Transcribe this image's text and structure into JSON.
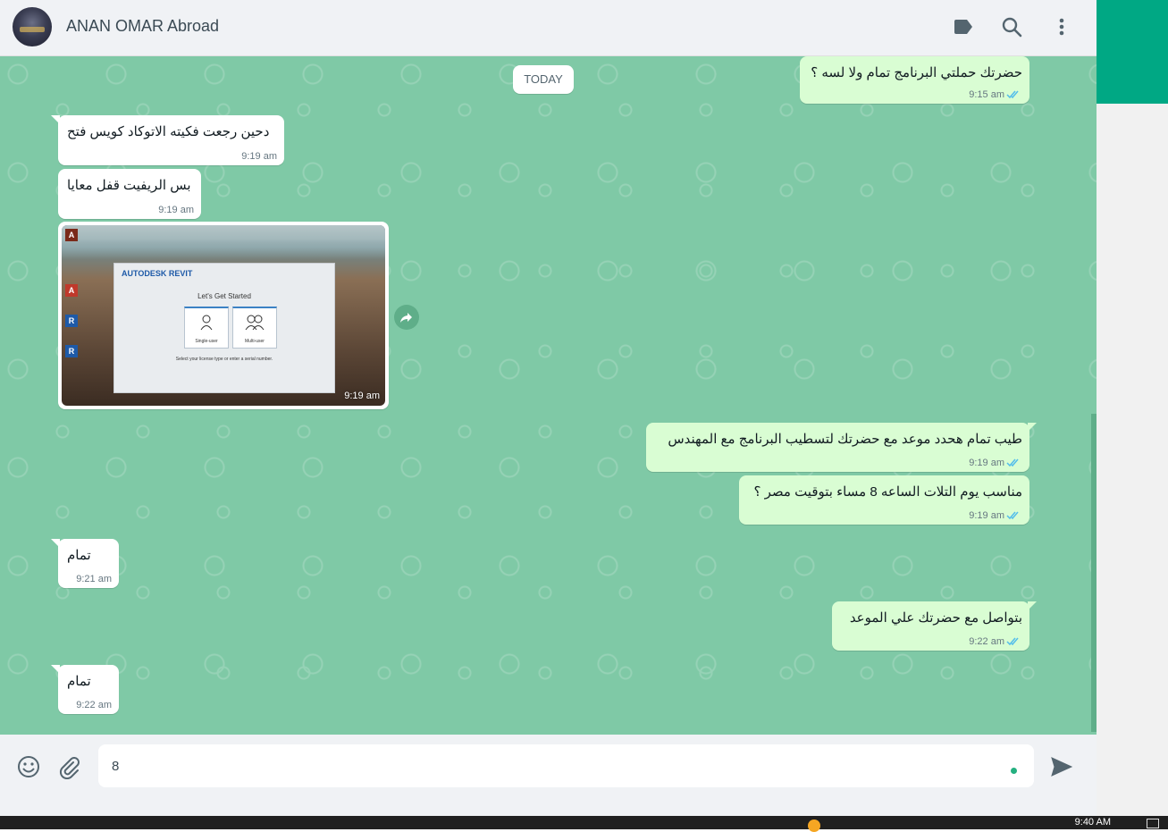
{
  "header": {
    "contact_name": "ANAN OMAR Abroad",
    "icons": [
      "label-icon",
      "search-icon",
      "menu-icon"
    ]
  },
  "chat": {
    "date_divider": "TODAY",
    "messages": [
      {
        "direction": "outgoing",
        "text": "حضرتك حملتي البرنامج تمام ولا لسه ؟",
        "time": "9:15 am",
        "status": "read"
      },
      {
        "direction": "incoming",
        "text": "دحين رجعت فكيته الاتوكاد كويس فتح",
        "time": "9:19 am"
      },
      {
        "direction": "incoming",
        "text": "بس الريفيت قفل معايا",
        "time": "9:19 am"
      },
      {
        "direction": "incoming",
        "type": "image",
        "time": "9:19 am",
        "image": {
          "dialog_logo": "AUTODESK REVIT",
          "dialog_title": "Let's Get Started",
          "option_1": "Single-user",
          "option_2": "Multi-user",
          "footer_text": "Select your license type or enter a serial number."
        }
      },
      {
        "direction": "outgoing",
        "text": "طيب تمام هحدد موعد مع حضرتك لتسطيب البرنامج مع المهندس",
        "time": "9:19 am",
        "status": "read"
      },
      {
        "direction": "outgoing",
        "text": "مناسب يوم التلات الساعه 8 مساء بتوقيت مصر ؟",
        "time": "9:19 am",
        "status": "read"
      },
      {
        "direction": "incoming",
        "text": "تمام",
        "time": "9:21 am"
      },
      {
        "direction": "outgoing",
        "text": "بتواصل مع حضرتك علي الموعد",
        "time": "9:22 am",
        "status": "read"
      },
      {
        "direction": "incoming",
        "text": "تمام",
        "time": "9:22 am"
      }
    ]
  },
  "composer": {
    "value": "8",
    "icons": [
      "emoji-icon",
      "attach-icon",
      "send-icon"
    ]
  },
  "taskbar": {
    "clock": "9:40 AM"
  },
  "colors": {
    "chat_background": "#7fc9a6",
    "incoming_bubble": "#ffffff",
    "outgoing_bubble": "#d9fdd3",
    "accent": "#00a884",
    "read_ticks": "#53bdeb"
  }
}
